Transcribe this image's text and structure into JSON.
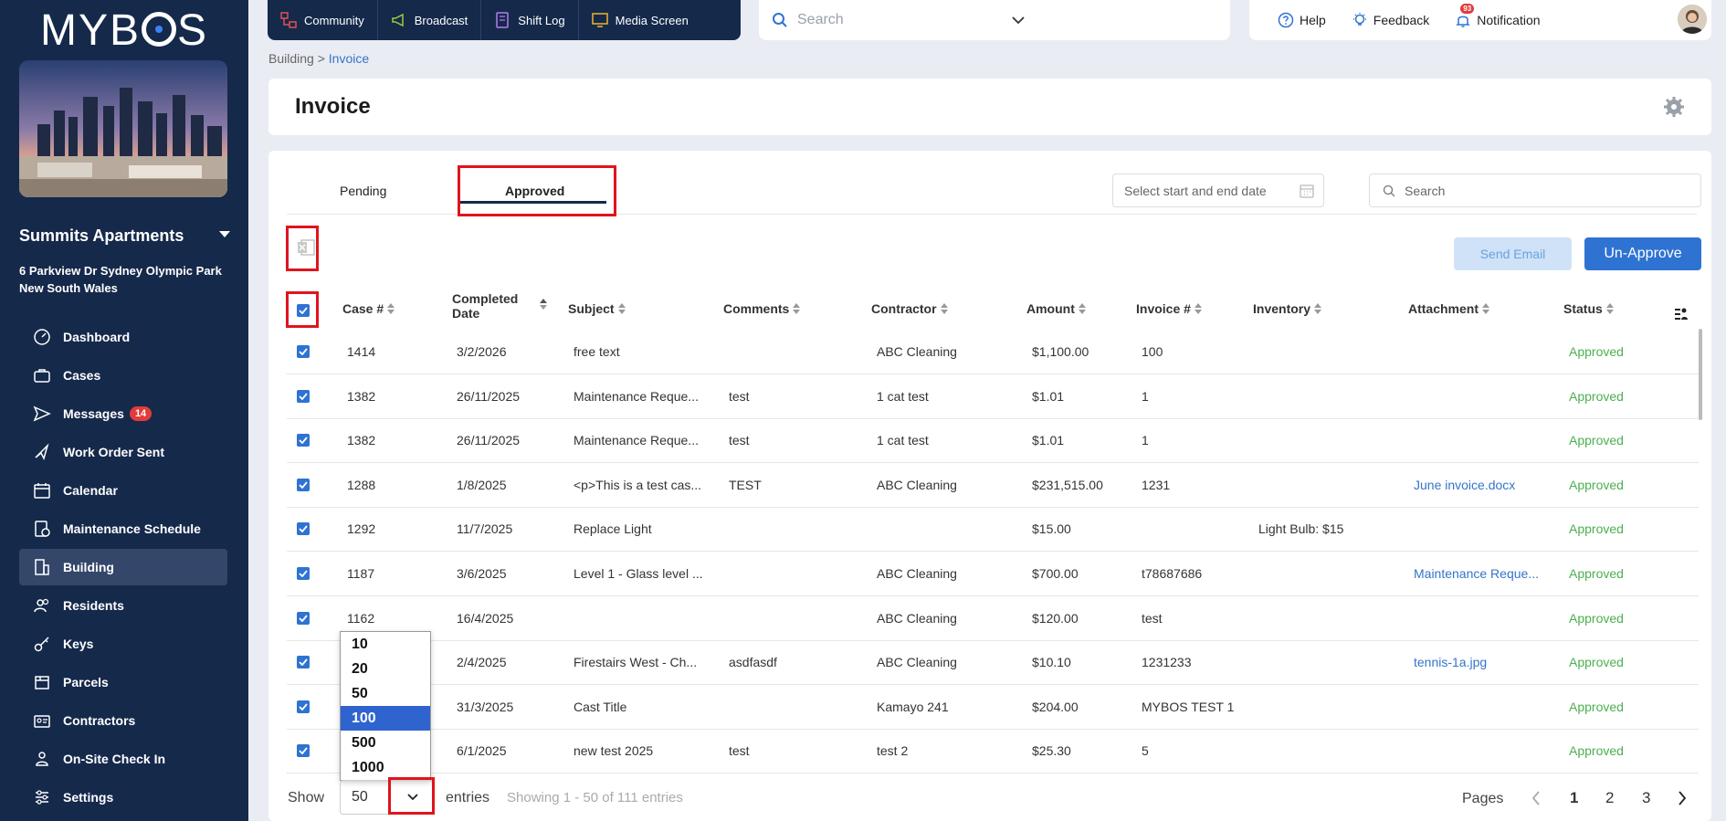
{
  "sidebar": {
    "logo": "MYBOS",
    "building_name": "Summits Apartments",
    "address": "6 Parkview Dr Sydney Olympic Park New South Wales",
    "items": [
      {
        "label": "Dashboard",
        "icon": "dashboard-icon"
      },
      {
        "label": "Cases",
        "icon": "briefcase-icon"
      },
      {
        "label": "Messages",
        "icon": "send-icon",
        "badge": "14"
      },
      {
        "label": "Work Order Sent",
        "icon": "megaphone-icon"
      },
      {
        "label": "Calendar",
        "icon": "calendar-icon"
      },
      {
        "label": "Maintenance Schedule",
        "icon": "schedule-icon"
      },
      {
        "label": "Building",
        "icon": "building-icon",
        "active": true
      },
      {
        "label": "Residents",
        "icon": "users-icon"
      },
      {
        "label": "Keys",
        "icon": "key-icon"
      },
      {
        "label": "Parcels",
        "icon": "parcel-icon"
      },
      {
        "label": "Contractors",
        "icon": "contractor-icon"
      },
      {
        "label": "On-Site Check In",
        "icon": "checkin-icon"
      },
      {
        "label": "Settings",
        "icon": "settings-icon"
      }
    ]
  },
  "topnav": {
    "items": [
      "Community",
      "Broadcast",
      "Shift Log",
      "Media Screen"
    ],
    "search_placeholder": "Search",
    "help": "Help",
    "feedback": "Feedback",
    "notification": "Notification",
    "notification_count": "93"
  },
  "breadcrumb": {
    "parent": "Building",
    "current": "Invoice"
  },
  "page": {
    "title": "Invoice"
  },
  "tabs": {
    "pending": "Pending",
    "approved": "Approved"
  },
  "filters": {
    "date_placeholder": "Select start and end date",
    "search_placeholder": "Search"
  },
  "actions": {
    "send_email": "Send Email",
    "un_approve": "Un-Approve"
  },
  "table": {
    "headers": {
      "case": "Case #",
      "completed_date_1": "Completed",
      "completed_date_2": "Date",
      "subject": "Subject",
      "comments": "Comments",
      "contractor": "Contractor",
      "amount": "Amount",
      "invoice": "Invoice #",
      "inventory": "Inventory",
      "attachment": "Attachment",
      "status": "Status"
    },
    "rows": [
      {
        "case": "1414",
        "date": "3/2/2026",
        "subject": "free text",
        "comments": "",
        "contractor": "ABC Cleaning",
        "amount": "$1,100.00",
        "invoice": "100",
        "inventory": "",
        "attachment": "",
        "status": "Approved"
      },
      {
        "case": "1382",
        "date": "26/11/2025",
        "subject": "Maintenance Reque...",
        "comments": "test",
        "contractor": "1 cat test",
        "amount": "$1.01",
        "invoice": "1",
        "inventory": "",
        "attachment": "",
        "status": "Approved"
      },
      {
        "case": "1382",
        "date": "26/11/2025",
        "subject": "Maintenance Reque...",
        "comments": "test",
        "contractor": "1 cat test",
        "amount": "$1.01",
        "invoice": "1",
        "inventory": "",
        "attachment": "",
        "status": "Approved"
      },
      {
        "case": "1288",
        "date": "1/8/2025",
        "subject": "<p>This is a test cas...",
        "comments": "TEST",
        "contractor": "ABC Cleaning",
        "amount": "$231,515.00",
        "invoice": "1231",
        "inventory": "",
        "attachment": "June invoice.docx",
        "status": "Approved"
      },
      {
        "case": "1292",
        "date": "11/7/2025",
        "subject": "Replace Light",
        "comments": "",
        "contractor": "",
        "amount": "$15.00",
        "invoice": "",
        "inventory": "Light Bulb: $15",
        "attachment": "",
        "status": "Approved"
      },
      {
        "case": "1187",
        "date": "3/6/2025",
        "subject": "Level 1 - Glass level ...",
        "comments": "",
        "contractor": "ABC Cleaning",
        "amount": "$700.00",
        "invoice": "t78687686",
        "inventory": "",
        "attachment": "Maintenance Reque...",
        "status": "Approved"
      },
      {
        "case": "1162",
        "date": "16/4/2025",
        "subject": "",
        "comments": "",
        "contractor": "ABC Cleaning",
        "amount": "$120.00",
        "invoice": "test",
        "inventory": "",
        "attachment": "",
        "status": "Approved"
      },
      {
        "case": "",
        "date": "2/4/2025",
        "subject": "Firestairs West - Ch...",
        "comments": "asdfasdf",
        "contractor": "ABC Cleaning",
        "amount": "$10.10",
        "invoice": "1231233",
        "inventory": "",
        "attachment": "tennis-1a.jpg",
        "status": "Approved"
      },
      {
        "case": "",
        "date": "31/3/2025",
        "subject": "Cast Title",
        "comments": "",
        "contractor": "Kamayo 241",
        "amount": "$204.00",
        "invoice": "MYBOS TEST 1",
        "inventory": "",
        "attachment": "",
        "status": "Approved"
      },
      {
        "case": "",
        "date": "6/1/2025",
        "subject": "new test 2025",
        "comments": "test",
        "contractor": "test 2",
        "amount": "$25.30",
        "invoice": "5",
        "inventory": "",
        "attachment": "",
        "status": "Approved"
      }
    ]
  },
  "pagination": {
    "show_label": "Show",
    "page_size": "50",
    "page_size_options": [
      "10",
      "20",
      "50",
      "100",
      "500",
      "1000"
    ],
    "highlighted_option": "100",
    "entries_label": "entries",
    "showing": "Showing 1 - 50 of 111 entries",
    "pages_label": "Pages",
    "pages": [
      "1",
      "2",
      "3"
    ],
    "current_page": "1"
  },
  "colors": {
    "sidebar": "#15294b",
    "accent": "#2f73d2",
    "status": "#4caf50",
    "highlight_box": "#e0141e"
  }
}
